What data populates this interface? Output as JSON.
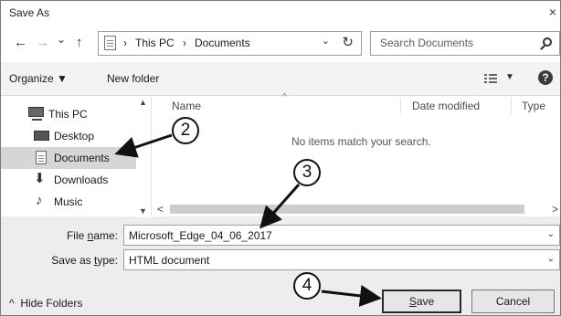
{
  "window": {
    "title": "Save As",
    "close_glyph": "×"
  },
  "navigation": {
    "back_glyph": "←",
    "forward_glyph": "→",
    "recent_glyph": "⌄",
    "up_glyph": "↑",
    "breadcrumb": [
      "This PC",
      "Documents"
    ],
    "breadcrumb_sep": "›",
    "address_dropdown_glyph": "⌄",
    "refresh_glyph": "↻",
    "search_placeholder": "Search Documents"
  },
  "command_bar": {
    "organize_label": "Organize ▼",
    "new_folder_label": "New folder",
    "view_drop_glyph": "▼",
    "help_glyph": "?"
  },
  "nav_pane": {
    "items": [
      {
        "label": "This PC",
        "icon": "computer-icon"
      },
      {
        "label": "Desktop",
        "icon": "desktop-icon"
      },
      {
        "label": "Documents",
        "icon": "documents-icon",
        "selected": true
      },
      {
        "label": "Downloads",
        "icon": "download-icon"
      },
      {
        "label": "Music",
        "icon": "music-icon"
      }
    ],
    "scroll_up_glyph": "▲",
    "scroll_down_glyph": "▼"
  },
  "file_list": {
    "columns": [
      "Name",
      "Date modified",
      "Type"
    ],
    "sort_glyph": "^",
    "empty_message": "No items match your search.",
    "scroll_left_glyph": "<",
    "scroll_right_glyph": ">"
  },
  "fields": {
    "file_name_label_pre": "File ",
    "file_name_label_key": "n",
    "file_name_label_post": "ame:",
    "file_name_value": "Microsoft_Edge_04_06_2017",
    "save_type_label_pre": "Save as ",
    "save_type_label_key": "t",
    "save_type_label_post": "ype:",
    "save_type_value": "HTML document",
    "dropdown_glyph": "⌄"
  },
  "footer": {
    "hide_folders_label": "Hide Folders",
    "hide_folders_glyph": "^",
    "save_key": "S",
    "save_rest": "ave",
    "cancel_label": "Cancel"
  },
  "callouts": [
    "2",
    "3",
    "4"
  ],
  "colors": {
    "selection": "#d6d6d6",
    "background": "#ededed",
    "annotation": "#111111"
  }
}
